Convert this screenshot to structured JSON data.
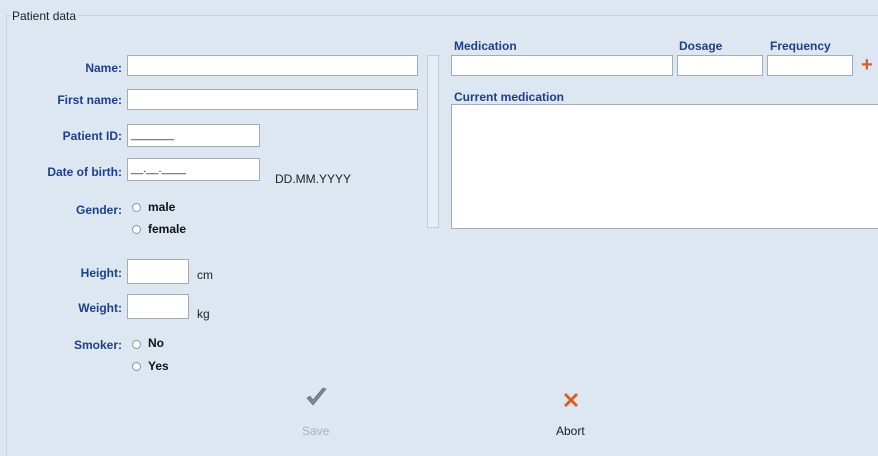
{
  "window": {
    "group_title": "Patient data"
  },
  "form": {
    "name_label": "Name:",
    "first_name_label": "First name:",
    "patient_id_label": "Patient ID:",
    "patient_id_mask": "_______",
    "dob_label": "Date of birth:",
    "dob_mask": "__.__.____",
    "dob_hint": "DD.MM.YYYY",
    "gender_label": "Gender:",
    "gender_options": [
      "male",
      "female"
    ],
    "height_label": "Height:",
    "height_unit": "cm",
    "weight_label": "Weight:",
    "weight_unit": "kg",
    "smoker_label": "Smoker:",
    "smoker_options": [
      "No",
      "Yes"
    ]
  },
  "medication": {
    "medication_header": "Medication",
    "dosage_header": "Dosage",
    "frequency_header": "Frequency",
    "current_header": "Current medication",
    "add_icon": "plus-icon"
  },
  "buttons": {
    "save_label": "Save",
    "abort_label": "Abort",
    "save_icon": "checkmark-icon",
    "abort_icon": "x-icon"
  },
  "colors": {
    "background": "#dde7f2",
    "label": "#1d3f8c",
    "add_icon": "#e25a1b",
    "abort_icon": "#e25a1b",
    "save_icon": "#7f8790"
  }
}
